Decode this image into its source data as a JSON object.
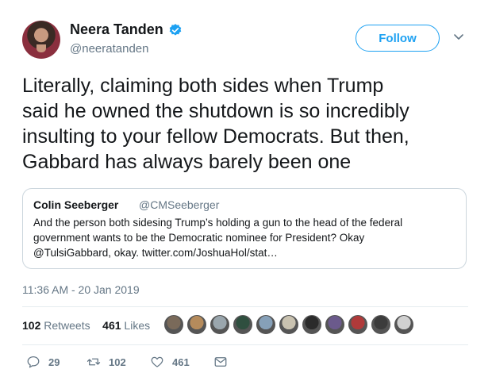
{
  "author": {
    "name": "Neera Tanden",
    "handle": "@neeratanden"
  },
  "follow_label": "Follow",
  "tweet_lines": [
    "Literally, claiming both sides when Trump",
    "said he owned the shutdown is so incredibly",
    "insulting to your fellow Democrats.  But then,",
    "Gabbard has always barely been one"
  ],
  "quoted": {
    "name": "Colin Seeberger",
    "handle": "@CMSeeberger",
    "lines": [
      "And the person both sidesing Trump’s holding a gun to the head of the federal",
      "government wants to be the Democratic nominee for President? Okay",
      "@TulsiGabbard, okay. twitter.com/JoshuaHol/stat…"
    ]
  },
  "timestamp": "11:36 AM - 20 Jan 2019",
  "stats": {
    "retweets_count": "102",
    "retweets_label": "Retweets",
    "likes_count": "461",
    "likes_label": "Likes"
  },
  "actions": {
    "replies": "29",
    "retweets": "102",
    "likes": "461"
  },
  "icons": [
    "verified-icon",
    "chevron-down-icon",
    "reply-icon",
    "retweet-icon",
    "like-icon",
    "message-icon"
  ],
  "colors": {
    "accent": "#1da1f2",
    "muted": "#657786",
    "text": "#14171a",
    "border": "#ccd6dd"
  },
  "facepile_colors": [
    "#7a6a5a",
    "#b58b5c",
    "#9aa6ad",
    "#2f4f3f",
    "#86a0b8",
    "#c9c2b0",
    "#2b2b2b",
    "#6b5a8c",
    "#b03a3a",
    "#3c3c3c",
    "#d0d0d0"
  ]
}
